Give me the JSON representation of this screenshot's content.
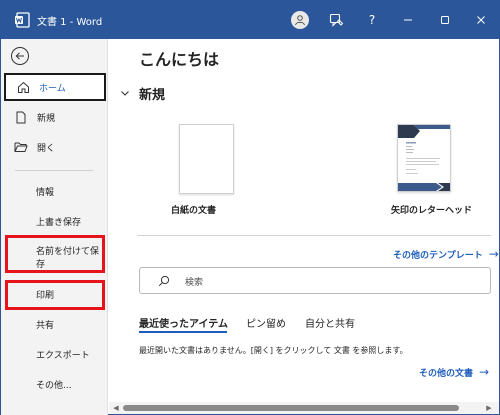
{
  "titlebar": {
    "title": "文書 1  -  Word",
    "help_label": "?"
  },
  "sidebar": {
    "items": [
      {
        "label": "ホーム"
      },
      {
        "label": "新規"
      },
      {
        "label": "開く"
      },
      {
        "label": "情報"
      },
      {
        "label": "上書き保存"
      },
      {
        "label": "名前を付けて保",
        "label2": "存"
      },
      {
        "label": "印刷"
      },
      {
        "label": "共有"
      },
      {
        "label": "エクスポート"
      },
      {
        "label": "その他..."
      }
    ]
  },
  "main": {
    "greeting": "こんにちは",
    "new_section": "新規",
    "templates": [
      {
        "label": "白紙の文書"
      },
      {
        "label": "矢印のレターヘッド"
      }
    ],
    "more_templates": "その他のテンプレート",
    "search_placeholder": "検索",
    "tabs": [
      {
        "label": "最近使ったアイテム"
      },
      {
        "label": "ピン留め"
      },
      {
        "label": "自分と共有"
      }
    ],
    "empty_message": "最近開いた文書はありません。[開く] をクリックして 文書 を参照します。",
    "more_documents": "その他の文書"
  },
  "colors": {
    "accent": "#2b579a",
    "link": "#1e5dbb",
    "highlight": "#e8141b"
  }
}
